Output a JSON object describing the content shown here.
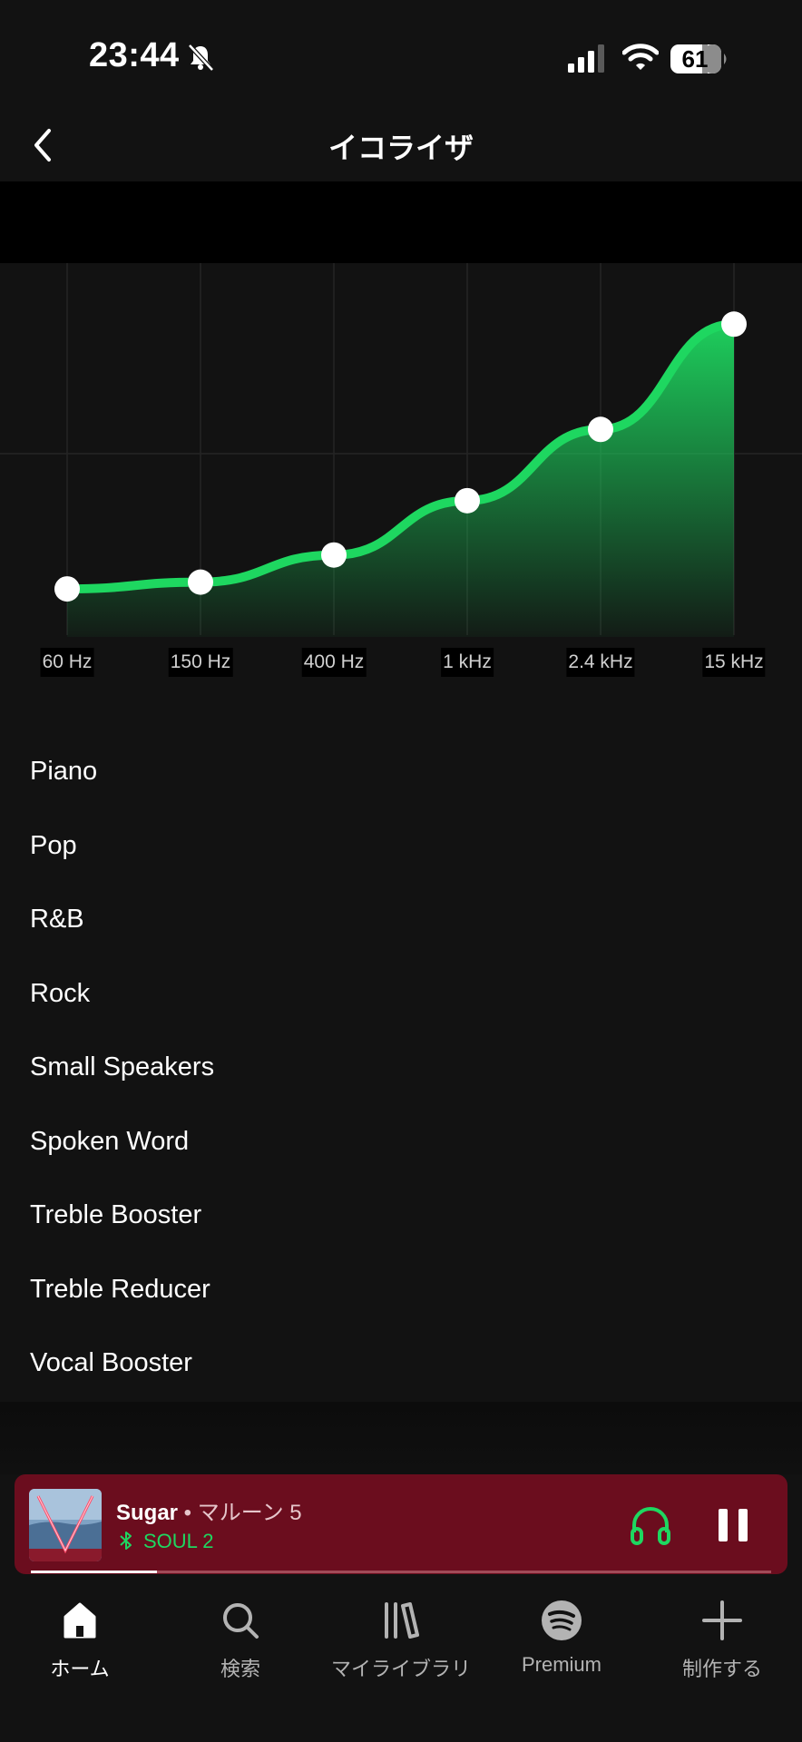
{
  "status_bar": {
    "time": "23:44",
    "battery": "61"
  },
  "header": {
    "title": "イコライザ"
  },
  "equalizer": {
    "bands": [
      {
        "label": "60 Hz",
        "level": 0.12
      },
      {
        "label": "150 Hz",
        "level": 0.14
      },
      {
        "label": "400 Hz",
        "level": 0.22
      },
      {
        "label": "1 kHz",
        "level": 0.38
      },
      {
        "label": "2.4 kHz",
        "level": 0.59
      },
      {
        "label": "15 kHz",
        "level": 0.9
      }
    ],
    "accent_color": "#1ed760"
  },
  "presets": [
    {
      "label": "Piano"
    },
    {
      "label": "Pop"
    },
    {
      "label": "R&B"
    },
    {
      "label": "Rock"
    },
    {
      "label": "Small Speakers"
    },
    {
      "label": "Spoken Word"
    },
    {
      "label": "Treble Booster"
    },
    {
      "label": "Treble Reducer"
    },
    {
      "label": "Vocal Booster"
    }
  ],
  "now_playing": {
    "title": "Sugar",
    "separator": " • ",
    "artist": "マルーン 5",
    "device": "SOUL 2",
    "progress": 0.17,
    "background_color": "#6b0d1e"
  },
  "nav": {
    "items": [
      {
        "label": "ホーム",
        "icon": "home-icon",
        "active": true
      },
      {
        "label": "検索",
        "icon": "search-icon",
        "active": false
      },
      {
        "label": "マイライブラリ",
        "icon": "library-icon",
        "active": false
      },
      {
        "label": "Premium",
        "icon": "spotify-icon",
        "active": false
      },
      {
        "label": "制作する",
        "icon": "plus-icon",
        "active": false
      }
    ]
  }
}
